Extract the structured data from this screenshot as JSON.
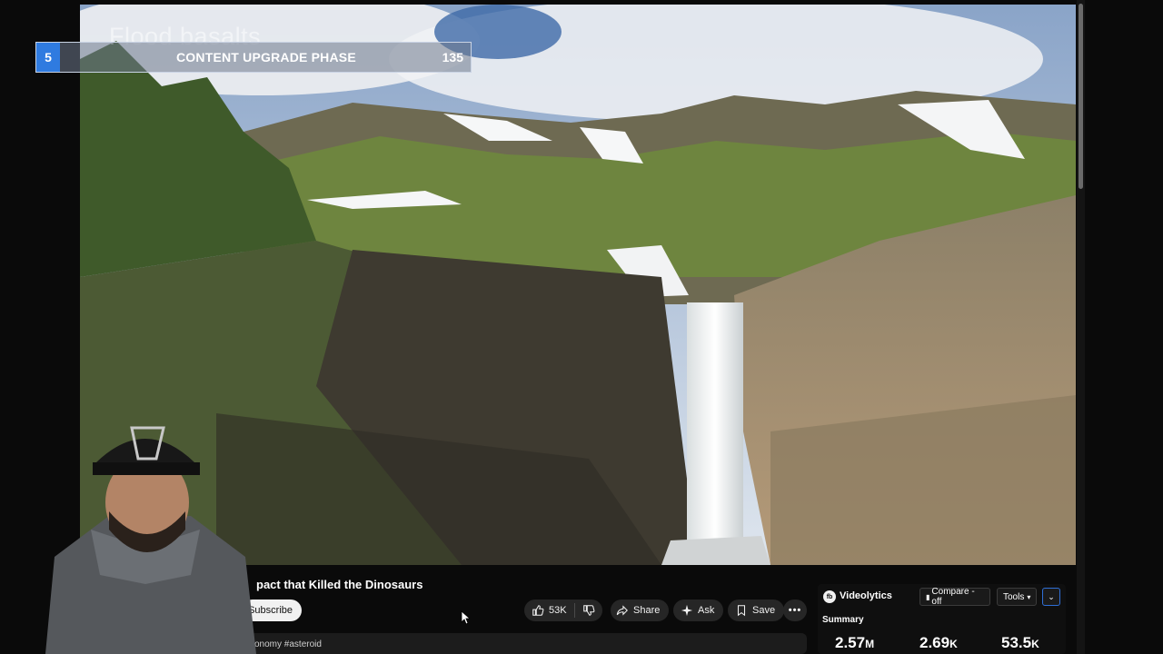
{
  "overlay": {
    "video_caption": "Flood basalts",
    "banner_number": "5",
    "banner_title": "CONTENT UPGRADE PHASE",
    "banner_count": "135"
  },
  "video": {
    "title_fragment": "pact that Killed the Dinosaurs",
    "subscribe_label": "Subscribe",
    "tags_fragment": "onomy #asteroid"
  },
  "actions": {
    "like_count": "53K",
    "share_label": "Share",
    "ask_label": "Ask",
    "save_label": "Save",
    "more_label": "•••"
  },
  "videolytics": {
    "logo_text": "fb",
    "name": "Videolytics",
    "compare_label": "Compare - off",
    "tools_label": "Tools",
    "summary_label": "Summary",
    "stats": [
      {
        "value": "2.57",
        "unit": "M"
      },
      {
        "value": "2.69",
        "unit": "K"
      },
      {
        "value": "53.5",
        "unit": "K"
      }
    ]
  },
  "colors": {
    "banner_accent": "#2f7be0",
    "pill_bg": "#262626",
    "panel_bg": "#0f0f0f"
  }
}
